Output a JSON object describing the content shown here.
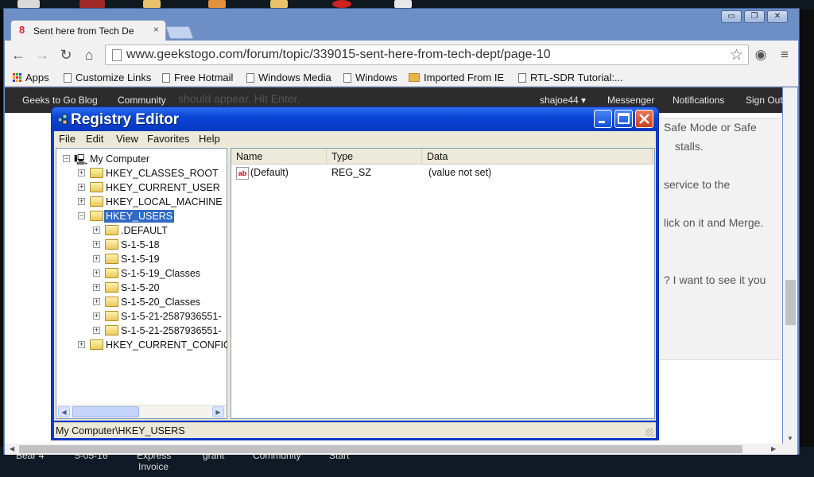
{
  "browser": {
    "tab_title": "Sent here from Tech De",
    "tab_close": "×",
    "url": "www.geekstogo.com/forum/topic/339015-sent-here-from-tech-dept/page-10",
    "window_controls": {
      "minimize": "▭",
      "restore": "❐",
      "close": "✕"
    },
    "bookmarks": [
      {
        "label": "Apps",
        "icon": "apps-grid-icon"
      },
      {
        "label": "Customize Links",
        "icon": "page-icon"
      },
      {
        "label": "Free Hotmail",
        "icon": "page-icon"
      },
      {
        "label": "Windows Media",
        "icon": "page-icon"
      },
      {
        "label": "Windows",
        "icon": "page-icon"
      },
      {
        "label": "Imported From IE",
        "icon": "folder-icon"
      },
      {
        "label": "RTL-SDR Tutorial:...",
        "icon": "page-icon"
      }
    ]
  },
  "site": {
    "nav_left": [
      "Geeks to Go Blog",
      "Community"
    ],
    "nav_right": [
      "shajoe44 ▾",
      "Messenger",
      "Notifications",
      "Sign Out"
    ],
    "overlapped_text": "should appear.  Hit Enter.",
    "post_lines": [
      "Safe Mode or Safe",
      "stalls.",
      "service to the",
      "lick on it and Merge.",
      "?  I want to see it you"
    ]
  },
  "taskbar": {
    "labels": [
      "Bear 4",
      "5-05-16",
      "Express",
      "Invoice",
      "grant",
      "Community",
      "Start"
    ]
  },
  "regedit": {
    "title": "Registry Editor",
    "menu": [
      "File",
      "Edit",
      "View",
      "Favorites",
      "Help"
    ],
    "tree": {
      "root": "My Computer",
      "hives": {
        "classes_root": "HKEY_CLASSES_ROOT",
        "current_user": "HKEY_CURRENT_USER",
        "local_machine": "HKEY_LOCAL_MACHINE",
        "users": "HKEY_USERS",
        "current_config": "HKEY_CURRENT_CONFIG"
      },
      "user_keys": [
        ".DEFAULT",
        "S-1-5-18",
        "S-1-5-19",
        "S-1-5-19_Classes",
        "S-1-5-20",
        "S-1-5-20_Classes",
        "S-1-5-21-2587936551-",
        "S-1-5-21-2587936551-"
      ],
      "selected": "HKEY_USERS"
    },
    "columns": {
      "name": "Name",
      "type": "Type",
      "data": "Data"
    },
    "values": [
      {
        "name": "(Default)",
        "type": "REG_SZ",
        "data": "(value not set)"
      }
    ],
    "status": "My Computer\\HKEY_USERS"
  },
  "colors": {
    "xp_title_blue": "#0a46d6",
    "selection": "#316ac5",
    "chrome_frame": "#6e8fc6"
  }
}
